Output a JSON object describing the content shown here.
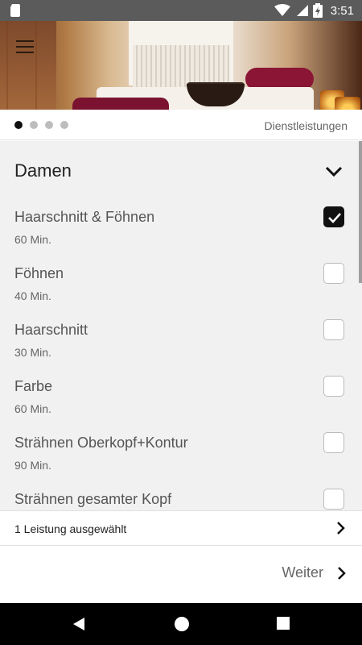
{
  "status_bar": {
    "time": "3:51",
    "icons": [
      "sd-card-icon",
      "wifi-icon",
      "signal-icon",
      "battery-icon"
    ]
  },
  "header": {
    "menu_icon": "hamburger-menu-icon"
  },
  "pager": {
    "total_pages": 4,
    "active_index": 0,
    "section_label": "Dienstleistungen"
  },
  "category": {
    "title": "Damen",
    "expanded": true
  },
  "services": [
    {
      "name": "Haarschnitt & Föhnen",
      "duration": "60 Min.",
      "selected": true
    },
    {
      "name": "Föhnen",
      "duration": "40 Min.",
      "selected": false
    },
    {
      "name": "Haarschnitt",
      "duration": "30 Min.",
      "selected": false
    },
    {
      "name": "Farbe",
      "duration": "60 Min.",
      "selected": false
    },
    {
      "name": "Strähnen Oberkopf+Kontur",
      "duration": "90 Min.",
      "selected": false
    },
    {
      "name": "Strähnen gesamter Kopf",
      "duration": "",
      "selected": false
    }
  ],
  "summary": {
    "text": "1 Leistung ausgewählt"
  },
  "footer": {
    "next_label": "Weiter"
  },
  "colors": {
    "accent": "#111111",
    "list_background": "#f1f1f1",
    "status_bar": "#5b5b5b"
  }
}
